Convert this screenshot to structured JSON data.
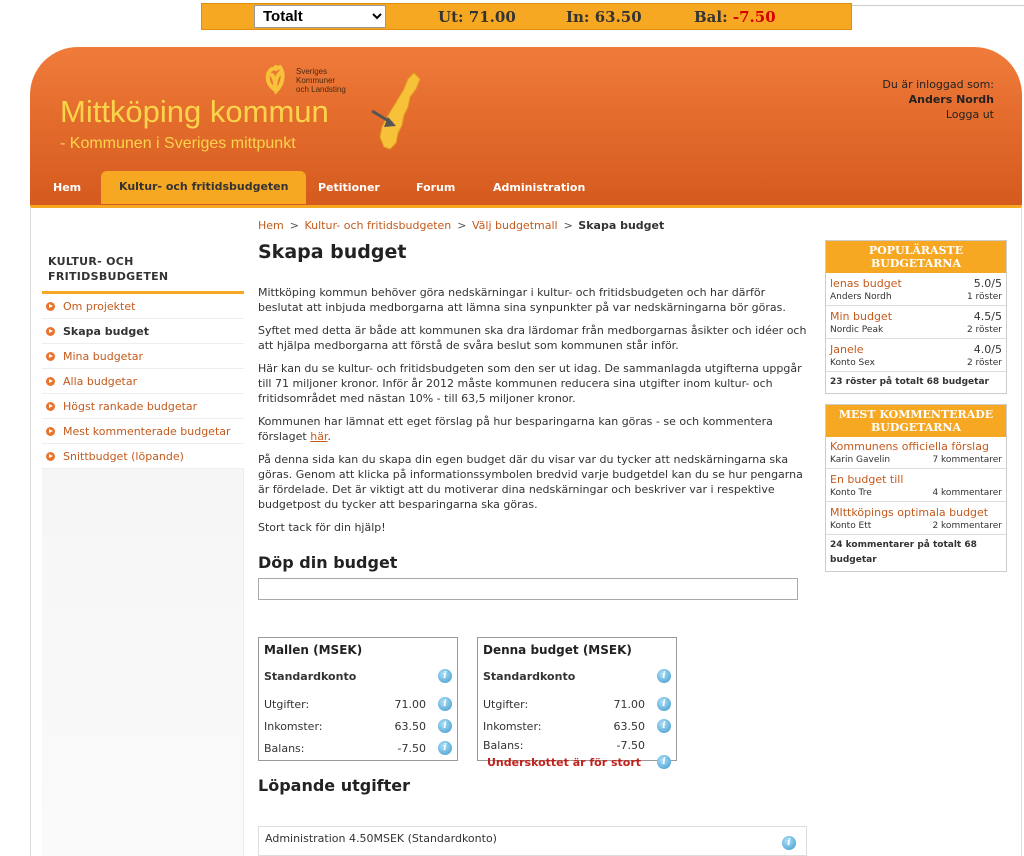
{
  "topbar": {
    "select_value": "Totalt",
    "out_label": "Ut:",
    "out_value": "71.00",
    "in_label": "In:",
    "in_value": "63.50",
    "bal_label": "Bal:",
    "bal_value": "-7.50"
  },
  "header": {
    "title": "Mittköping kommun",
    "subtitle": "- Kommunen i Sveriges mittpunkt",
    "skl_line1": "Sveriges",
    "skl_line2": "Kommuner",
    "skl_line3": "och Landsting",
    "logged_in_label": "Du är inloggad som:",
    "user_name": "Anders Nordh",
    "logout": "Logga ut"
  },
  "nav": {
    "tabs": [
      {
        "label": "Hem"
      },
      {
        "label": "Kultur- och fritidsbudgeten"
      },
      {
        "label": "Petitioner"
      },
      {
        "label": "Forum"
      },
      {
        "label": "Administration"
      }
    ]
  },
  "sidebar": {
    "title_line1": "KULTUR- OCH",
    "title_line2": "FRITIDSBUDGETEN",
    "items": [
      {
        "label": "Om projektet"
      },
      {
        "label": "Skapa budget"
      },
      {
        "label": "Mina budgetar"
      },
      {
        "label": "Alla budgetar"
      },
      {
        "label": "Högst rankade budgetar"
      },
      {
        "label": "Mest kommenterade budgetar"
      },
      {
        "label": "Snittbudget (löpande)"
      }
    ]
  },
  "breadcrumb": {
    "items": [
      "Hem",
      "Kultur- och fritidsbudgeten",
      "Välj budgetmall"
    ],
    "current": "Skapa budget",
    "sep": ">"
  },
  "main": {
    "title": "Skapa budget",
    "p1": "Mittköping kommun behöver göra nedskärningar i kultur- och fritidsbudgeten och har därför beslutat att inbjuda medborgarna att lämna sina synpunkter på var nedskärningarna bör göras.",
    "p2": "Syftet med detta är både att kommunen ska dra lärdomar från medborgarnas åsikter och idéer och att hjälpa medborgarna att förstå de svåra beslut som kommunen står inför.",
    "p3": "Här kan du se kultur- och fritidsbudgeten som den ser ut idag. De sammanlagda utgifterna uppgår till 71 miljoner kronor. Inför år 2012 måste kommunen reducera sina utgifter inom kultur- och fritidsområdet med nästan 10% - till 63,5 miljoner kronor.",
    "p4": "Kommunen har lämnat ett eget förslag på hur besparingarna kan göras - se och kommentera förslaget",
    "p4_link": "här",
    "p5": "På denna sida kan du skapa din egen budget där du visar var du tycker att nedskärningarna ska göras. Genom att klicka på informationssymbolen bredvid varje budgetdel kan du se hur pengarna är fördelade. Det är viktigt att du motiverar dina nedskärningar och beskriver var i respektive budgetpost du tycker att besparingarna ska göras.",
    "p6": "Stort tack för din hjälp!",
    "name_heading": "Döp din budget",
    "name_value": "",
    "expenses_heading": "Löpande utgifter"
  },
  "template_box": {
    "title": "Mallen (MSEK)",
    "account": "Standardkonto",
    "rows": [
      {
        "label": "Utgifter:",
        "value": "71.00"
      },
      {
        "label": "Inkomster:",
        "value": "63.50"
      },
      {
        "label": "Balans:",
        "value": "-7.50"
      }
    ]
  },
  "budget_box": {
    "title": "Denna budget (MSEK)",
    "account": "Standardkonto",
    "rows": [
      {
        "label": "Utgifter:",
        "value": "71.00"
      },
      {
        "label": "Inkomster:",
        "value": "63.50"
      },
      {
        "label": "Balans:",
        "value": "-7.50"
      }
    ],
    "warning": "Underskottet är för stort"
  },
  "expense_item": {
    "label": "Administration 4.50MSEK (Standardkonto)"
  },
  "popular": {
    "title": "POPULÄRASTE BUDGETARNA",
    "items": [
      {
        "name": "lenas budget",
        "score": "5.0/5",
        "author": "Anders Nordh",
        "votes": "1 röster"
      },
      {
        "name": "Min budget",
        "score": "4.5/5",
        "author": "Nordic Peak",
        "votes": "2 röster"
      },
      {
        "name": "Janele",
        "score": "4.0/5",
        "author": "Konto Sex",
        "votes": "2 röster"
      }
    ],
    "footer": "23 röster på totalt 68 budgetar"
  },
  "commented": {
    "title": "MEST KOMMENTERADE BUDGETARNA",
    "items": [
      {
        "name": "Kommunens officiella förslag",
        "author": "Karin Gavelin",
        "comments": "7 kommentarer"
      },
      {
        "name": "En budget till",
        "author": "Konto Tre",
        "comments": "4 kommentarer"
      },
      {
        "name": "MIttköpings optimala budget",
        "author": "Konto Ett",
        "comments": "2 kommentarer"
      }
    ],
    "footer": "24 kommentarer på totalt 68 budgetar"
  },
  "info_glyph": "i",
  "colors": {
    "accent": "#f7a823",
    "header": "#e0652a",
    "link": "#c45a1c",
    "negative": "#d40000",
    "warning": "#c0201a"
  }
}
